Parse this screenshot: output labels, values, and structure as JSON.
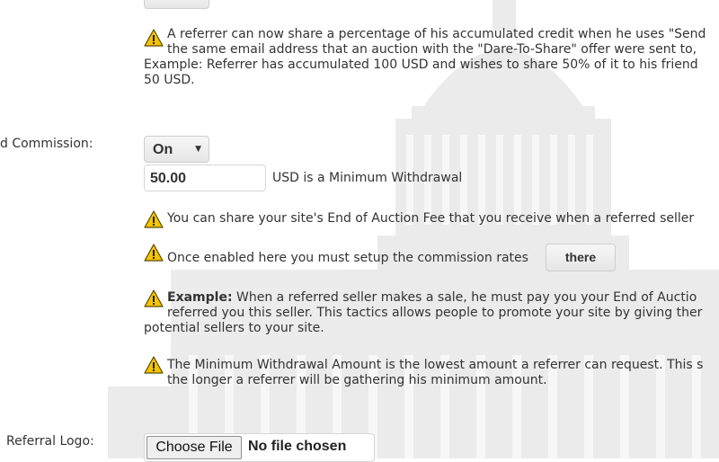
{
  "form": {
    "top_button_stub": "",
    "notes_top": {
      "line1": "A referrer can now share a percentage of his accumulated credit when he uses \"Send",
      "line2": "the same email address that an auction with the \"Dare-To-Share\" offer were sent to,",
      "line3": "Example: Referrer has accumulated 100 USD and wishes to share 50% of it to his friend",
      "line4": "50 USD."
    },
    "commission": {
      "label": "d Commission:",
      "select_value": "On",
      "min_withdrawal_value": "50.00",
      "min_withdrawal_suffix": "USD is a Minimum Withdrawal"
    },
    "notes": {
      "share_fee": "You can share your site's End of Auction Fee that you receive when a referred seller",
      "setup_rates": "Once enabled here you must setup the commission rates",
      "there_button": "there",
      "example_bold": "Example:",
      "example_line1": "When a referred seller makes a sale, he must pay you your End of Auctio",
      "example_line2": "referred you this seller. This tactics allows people to promote your site by giving ther",
      "example_line3": "potential sellers to your site.",
      "min_amount_line1": "The Minimum Withdrawal Amount is the lowest amount a referrer can request. This s",
      "min_amount_line2": "the longer a referrer will be gathering his minimum amount."
    },
    "referral_logo": {
      "label": "Referral Logo:",
      "choose_file": "Choose File",
      "file_status": "No file chosen"
    }
  },
  "colors": {
    "warning_fill": "#f5c400",
    "warning_stroke": "#5a4a00"
  },
  "icons": {
    "warning": "warning-icon",
    "select_caret": "chevron-down-icon"
  }
}
